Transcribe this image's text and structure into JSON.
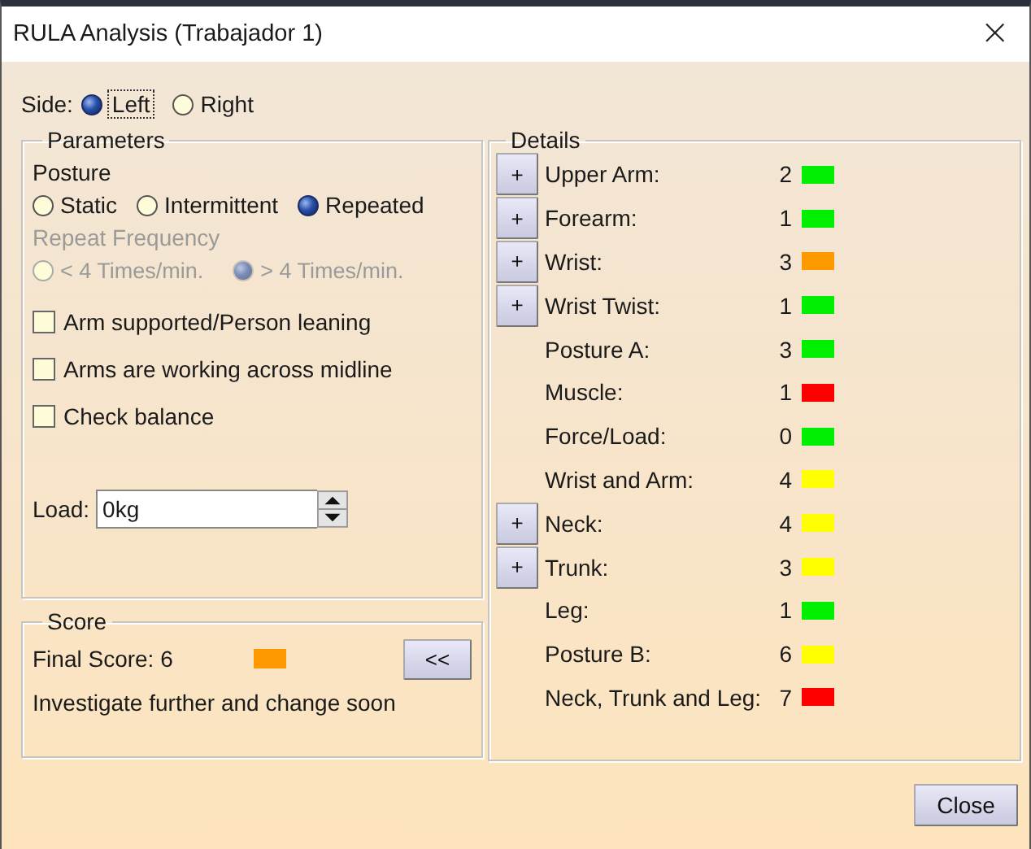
{
  "window": {
    "title": "RULA Analysis (Trabajador 1)",
    "close": "×"
  },
  "side": {
    "label": "Side:",
    "options": [
      {
        "label": "Left",
        "selected": true
      },
      {
        "label": "Right",
        "selected": false
      }
    ]
  },
  "parameters": {
    "title": "Parameters",
    "posture": {
      "label": "Posture",
      "options": [
        {
          "label": "Static",
          "selected": false
        },
        {
          "label": "Intermittent",
          "selected": false
        },
        {
          "label": "Repeated",
          "selected": true
        }
      ]
    },
    "repeat_frequency": {
      "label": "Repeat Frequency",
      "disabled": true,
      "options": [
        {
          "label": "< 4 Times/min.",
          "selected": false
        },
        {
          "label": "> 4 Times/min.",
          "selected": true
        }
      ]
    },
    "checks": [
      {
        "label": "Arm supported/Person leaning",
        "checked": false
      },
      {
        "label": "Arms are working across midline",
        "checked": false
      },
      {
        "label": "Check balance",
        "checked": false
      }
    ],
    "load": {
      "label": "Load:",
      "value": "0kg"
    }
  },
  "score": {
    "title": "Score",
    "final": "Final Score: 6",
    "color": "#ff9900",
    "message": "Investigate further and change soon",
    "collapse_button": "<<"
  },
  "details": {
    "title": "Details",
    "items": [
      {
        "button": "+",
        "label": "Upper Arm:",
        "value": "2",
        "color": "#00ee00"
      },
      {
        "button": "+",
        "label": "Forearm:",
        "value": "1",
        "color": "#00ee00"
      },
      {
        "button": "+",
        "label": "Wrist:",
        "value": "3",
        "color": "#ff9900"
      },
      {
        "button": "+",
        "label": "Wrist Twist:",
        "value": "1",
        "color": "#00ee00"
      },
      {
        "label": "Posture A:",
        "value": "3",
        "color": "#00ee00"
      },
      {
        "label": "Muscle:",
        "value": "1",
        "color": "#ff0000"
      },
      {
        "label": "Force/Load:",
        "value": "0",
        "color": "#00ee00"
      },
      {
        "label": "Wrist and Arm:",
        "value": "4",
        "color": "#ffff00"
      },
      {
        "button": "+",
        "label": "Neck:",
        "value": "4",
        "color": "#ffff00"
      },
      {
        "button": "+",
        "label": "Trunk:",
        "value": "3",
        "color": "#ffff00"
      },
      {
        "label": "Leg:",
        "value": "1",
        "color": "#00ee00"
      },
      {
        "label": "Posture B:",
        "value": "6",
        "color": "#ffff00"
      },
      {
        "label": "Neck, Trunk and Leg:",
        "value": "7",
        "color": "#ff0000"
      }
    ]
  },
  "close_button": "Close"
}
